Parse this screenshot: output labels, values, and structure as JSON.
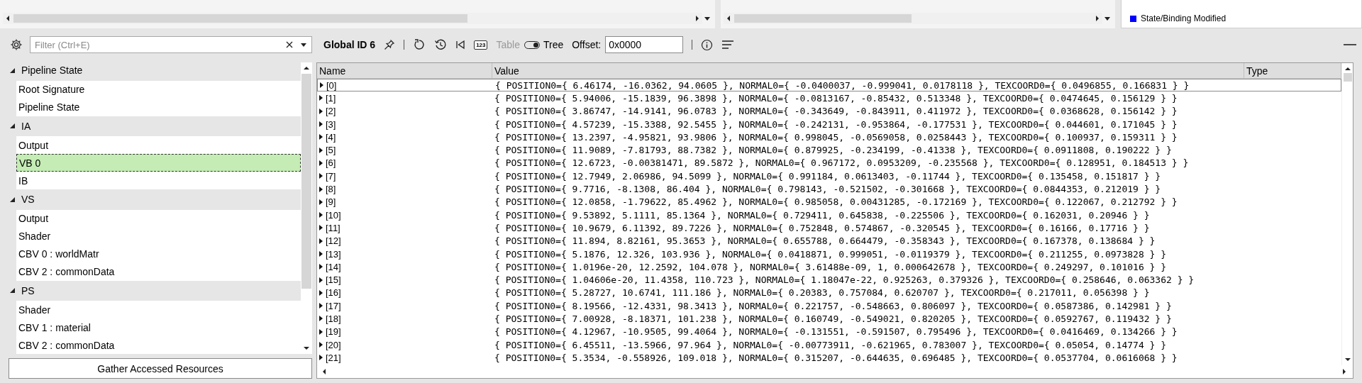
{
  "legend": [
    {
      "label": "State/Binding Modified",
      "color": "#0000ff"
    }
  ],
  "sidebar": {
    "filter": {
      "placeholder": "Filter (Ctrl+E)"
    },
    "tree": [
      {
        "label": "Pipeline State",
        "expanded": true,
        "children": [
          {
            "label": "Root Signature",
            "selected": false
          },
          {
            "label": "Pipeline State",
            "selected": false
          }
        ]
      },
      {
        "label": "IA",
        "expanded": true,
        "children": [
          {
            "label": "Output",
            "selected": false
          },
          {
            "label": "VB 0",
            "selected": true
          },
          {
            "label": "IB",
            "selected": false
          }
        ]
      },
      {
        "label": "VS",
        "expanded": true,
        "children": [
          {
            "label": "Output",
            "selected": false
          },
          {
            "label": "Shader",
            "selected": false
          },
          {
            "label": "CBV 0 : worldMatr",
            "selected": false
          },
          {
            "label": "CBV 2 : commonData",
            "selected": false
          }
        ]
      },
      {
        "label": "PS",
        "expanded": true,
        "children": [
          {
            "label": "Shader",
            "selected": false
          },
          {
            "label": "CBV 1 : material",
            "selected": false
          },
          {
            "label": "CBV 2 : commonData",
            "selected": false
          }
        ]
      }
    ],
    "button": "Gather Accessed Resources"
  },
  "toolbar": {
    "title": "Global ID 6",
    "number_button": "123",
    "table_label": "Table",
    "tree_label": "Tree",
    "tree_on": true,
    "offset_label": "Offset:",
    "offset_value": "0x0000"
  },
  "table": {
    "columns": [
      "Name",
      "Value",
      "Type"
    ],
    "rows": [
      {
        "name": "[0]",
        "value": "{ POSITION0={ 6.46174, -16.0362, 94.0605 }, NORMAL0={ -0.0400037, -0.999041, 0.0178118 }, TEXCOORD0={ 0.0496855, 0.166831 } }",
        "selected": true,
        "expanded": false
      },
      {
        "name": "[1]",
        "value": "{ POSITION0={ 5.94006, -15.1839, 96.3898 }, NORMAL0={ -0.0813167, -0.85432, 0.513348 }, TEXCOORD0={ 0.0474645, 0.156129 } }",
        "selected": false,
        "expanded": false
      },
      {
        "name": "[2]",
        "value": "{ POSITION0={ 3.86747, -14.9141, 96.0783 }, NORMAL0={ -0.343649, -0.843911, 0.411972 }, TEXCOORD0={ 0.0368628, 0.156142 } }",
        "selected": false,
        "expanded": false
      },
      {
        "name": "[3]",
        "value": "{ POSITION0={ 4.57239, -15.3388, 92.5455 }, NORMAL0={ -0.242131, -0.953864, -0.177531 }, TEXCOORD0={ 0.044601, 0.171045 } }",
        "selected": false,
        "expanded": false
      },
      {
        "name": "[4]",
        "value": "{ POSITION0={ 13.2397, -4.95821, 93.9806 }, NORMAL0={ 0.998045, -0.0569058, 0.0258443 }, TEXCOORD0={ 0.100937, 0.159311 } }",
        "selected": false,
        "expanded": false
      },
      {
        "name": "[5]",
        "value": "{ POSITION0={ 11.9089, -7.81793, 88.7382 }, NORMAL0={ 0.879925, -0.234199, -0.41338 }, TEXCOORD0={ 0.0911808, 0.190222 } }",
        "selected": false,
        "expanded": false
      },
      {
        "name": "[6]",
        "value": "{ POSITION0={ 12.6723, -0.00381471, 89.5872 }, NORMAL0={ 0.967172, 0.0953209, -0.235568 }, TEXCOORD0={ 0.128951, 0.184513 } }",
        "selected": false,
        "expanded": false
      },
      {
        "name": "[7]",
        "value": "{ POSITION0={ 12.7949, 2.06986, 94.5099 }, NORMAL0={ 0.991184, 0.0613403, -0.11744 }, TEXCOORD0={ 0.135458, 0.151817 } }",
        "selected": false,
        "expanded": false
      },
      {
        "name": "[8]",
        "value": "{ POSITION0={ 9.7716, -8.1308, 86.404 }, NORMAL0={ 0.798143, -0.521502, -0.301668 }, TEXCOORD0={ 0.0844353, 0.212019 } }",
        "selected": false,
        "expanded": false
      },
      {
        "name": "[9]",
        "value": "{ POSITION0={ 12.0858, -1.79622, 85.4962 }, NORMAL0={ 0.985058, 0.00431285, -0.172169 }, TEXCOORD0={ 0.122067, 0.212792 } }",
        "selected": false,
        "expanded": false
      },
      {
        "name": "[10]",
        "value": "{ POSITION0={ 9.53892, 5.1111, 85.1364 }, NORMAL0={ 0.729411, 0.645838, -0.225506 }, TEXCOORD0={ 0.162031, 0.20946 } }",
        "selected": false,
        "expanded": false
      },
      {
        "name": "[11]",
        "value": "{ POSITION0={ 10.9679, 6.11392, 89.7226 }, NORMAL0={ 0.752848, 0.574867, -0.320545 }, TEXCOORD0={ 0.16166, 0.17716 } }",
        "selected": false,
        "expanded": false
      },
      {
        "name": "[12]",
        "value": "{ POSITION0={ 11.894, 8.82161, 95.3653 }, NORMAL0={ 0.655788, 0.664479, -0.358343 }, TEXCOORD0={ 0.167378, 0.138684 } }",
        "selected": false,
        "expanded": false
      },
      {
        "name": "[13]",
        "value": "{ POSITION0={ 5.1876, 12.326, 103.936 }, NORMAL0={ 0.0418871, 0.999051, -0.0119379 }, TEXCOORD0={ 0.211255, 0.0973828 } }",
        "selected": false,
        "expanded": false
      },
      {
        "name": "[14]",
        "value": "{ POSITION0={ 1.0196e-20, 12.2592, 104.078 }, NORMAL0={ 3.61488e-09, 1, 0.000642678 }, TEXCOORD0={ 0.249297, 0.101016 } }",
        "selected": false,
        "expanded": false
      },
      {
        "name": "[15]",
        "value": "{ POSITION0={ 1.04606e-20, 11.4358, 110.723 }, NORMAL0={ 1.18047e-22, 0.925263, 0.379326 }, TEXCOORD0={ 0.258646, 0.063362 } }",
        "selected": false,
        "expanded": false
      },
      {
        "name": "[16]",
        "value": "{ POSITION0={ 5.28727, 10.6741, 111.186 }, NORMAL0={ 0.20383, 0.757084, 0.620707 }, TEXCOORD0={ 0.217011, 0.056398 } }",
        "selected": false,
        "expanded": false
      },
      {
        "name": "[17]",
        "value": "{ POSITION0={ 8.19566, -12.4331, 98.3413 }, NORMAL0={ 0.221757, -0.548663, 0.806097 }, TEXCOORD0={ 0.0587386, 0.142981 } }",
        "selected": false,
        "expanded": false
      },
      {
        "name": "[18]",
        "value": "{ POSITION0={ 7.00928, -8.18371, 101.238 }, NORMAL0={ 0.160749, -0.549021, 0.820205 }, TEXCOORD0={ 0.0592767, 0.119432 } }",
        "selected": false,
        "expanded": false
      },
      {
        "name": "[19]",
        "value": "{ POSITION0={ 4.12967, -10.9505, 99.4064 }, NORMAL0={ -0.131551, -0.591507, 0.795496 }, TEXCOORD0={ 0.0416469, 0.134266 } }",
        "selected": false,
        "expanded": false
      },
      {
        "name": "[20]",
        "value": "{ POSITION0={ 6.45511, -13.5966, 97.964 }, NORMAL0={ -0.00773911, -0.621965, 0.783007 }, TEXCOORD0={ 0.05054, 0.14774 } }",
        "selected": false,
        "expanded": false
      },
      {
        "name": "[21]",
        "value": "{ POSITION0={ 5.3534, -0.558926, 109.018 }, NORMAL0={ 0.315207, -0.644635, 0.696485 }, TEXCOORD0={ 0.0537704, 0.0616068 } }",
        "selected": false,
        "expanded": false
      }
    ]
  }
}
